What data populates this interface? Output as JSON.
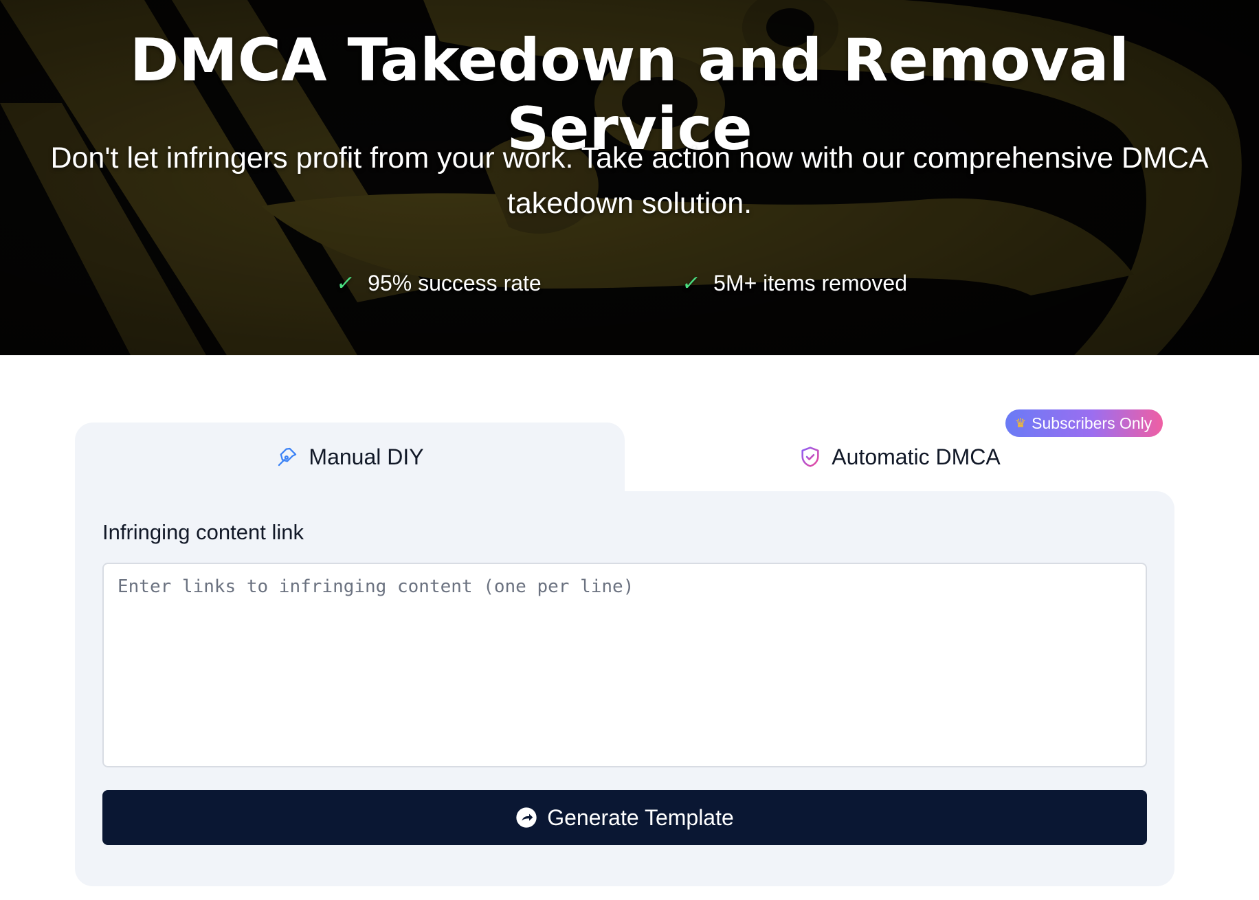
{
  "hero": {
    "title": "DMCA Takedown and Removal Service",
    "subtitle": "Don't let infringers profit from your work. Take action now with our comprehensive DMCA takedown solution.",
    "features": [
      {
        "icon": "check-icon",
        "label": "95% success rate"
      },
      {
        "icon": "check-icon",
        "label": "5M+ items removed"
      }
    ],
    "check_glyph": "✓"
  },
  "tabs": {
    "manual": {
      "label": "Manual DIY",
      "icon": "pen-nib-icon",
      "active": true
    },
    "automatic": {
      "label": "Automatic DMCA",
      "icon": "shield-check-icon",
      "active": false
    },
    "badge": {
      "icon": "crown-icon",
      "label": "Subscribers Only"
    }
  },
  "form": {
    "label": "Infringing content link",
    "value": "",
    "placeholder": "Enter links to infringing content (one per line)",
    "submit_label": "Generate Template",
    "submit_icon": "arrow-circle-icon"
  },
  "colors": {
    "accent": "#0a1733",
    "panel": "#f1f4f9",
    "check": "#4ade80",
    "badge_gradient": [
      "#6a7bf5",
      "#9b6ef0",
      "#ef5fa3"
    ]
  }
}
